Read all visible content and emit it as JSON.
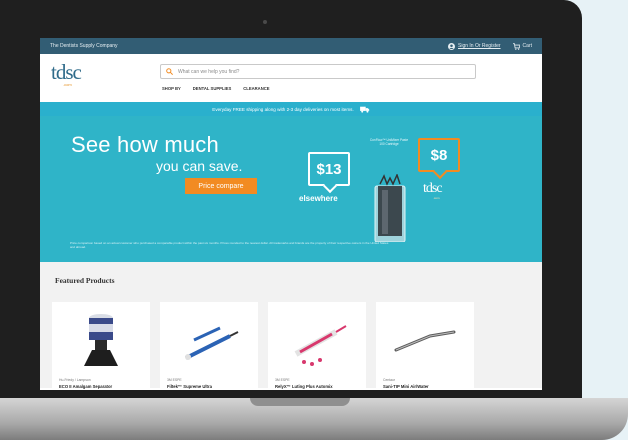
{
  "topbar": {
    "tagline": "The Dentists Supply Company",
    "signin": "Sign In Or Register",
    "cart": "Cart"
  },
  "logo": {
    "word": "tdsc",
    "sub": ".com"
  },
  "search": {
    "placeholder": "What can we help you find?"
  },
  "nav": [
    "SHOP BY",
    "DENTAL SUPPLIES",
    "CLEARANCE"
  ],
  "shipbar": {
    "text": "Everyday FREE shipping along with 2-3 day deliveries on most items."
  },
  "hero": {
    "headline": "See how much",
    "subheadline": "you can save.",
    "button": "Price compare",
    "price_elsewhere": "$13",
    "elsewhere_label": "elsewhere",
    "price_tdsc": "$8",
    "side_note": "ConFlow™ UniMixer Paste 100 Cartridge",
    "disclaimer": "Price comparison based on an actual customer who purchased a comparable product within the past six months. Prices rounded to the nearest dollar. All trademarks and brands are the property of their respective owners in the United States and abroad."
  },
  "featured": {
    "title": "Featured Products",
    "products": [
      {
        "brand": "Hu-Friedy / Lampson",
        "name": "ECO II Amalgam Separator"
      },
      {
        "brand": "3M ESPE",
        "name": "Filtek™ Supreme Ultra"
      },
      {
        "brand": "3M ESPE",
        "name": "RelyX™ Luting Plus Automix"
      },
      {
        "brand": "Centaur",
        "name": "Sani-TIP Mini Air/Water"
      }
    ]
  },
  "colors": {
    "topbar": "#325d74",
    "shipbar": "#2ab0cd",
    "hero": "#2fb4c8",
    "accent": "#f28b22"
  }
}
